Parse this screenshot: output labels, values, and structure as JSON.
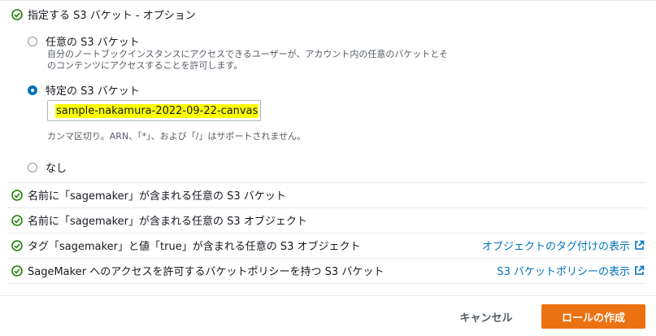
{
  "section_title": "指定する S3 バケット - オプション",
  "options": [
    {
      "label": "任意の S3 バケット",
      "selected": false,
      "desc1": "自分のノートブックインスタンスにアクセスできるユーザーが、アカウント内の任意のバケットとそ",
      "desc2": "のコンテンツにアクセスすることを許可します。"
    },
    {
      "label": "特定の S3 バケット",
      "selected": true
    },
    {
      "label": "なし",
      "selected": false
    }
  ],
  "bucket_input": {
    "value": "sample-nakamura-2022-09-22-canvas"
  },
  "hint": "カンマ区切り。ARN、「*」、および「/」はサポートされません。",
  "permissions": [
    {
      "label": "名前に「sagemaker」が含まれる任意の S3 バケット"
    },
    {
      "label": "名前に「sagemaker」が含まれる任意の S3 オブジェクト"
    },
    {
      "label": "タグ「sagemaker」と値「true」が含まれる任意の S3 オブジェクト",
      "link": "オブジェクトのタグ付けの表示"
    },
    {
      "label": "SageMaker へのアクセスを許可するバケットポリシーを持つ S3 バケット",
      "link": "S3 バケットポリシーの表示"
    }
  ],
  "buttons": {
    "cancel": "キャンセル",
    "create": "ロールの作成"
  },
  "colors": {
    "accent": "#0073bb",
    "check": "#1d8102",
    "primary": "#ec7211",
    "highlight": "#ffff00"
  }
}
